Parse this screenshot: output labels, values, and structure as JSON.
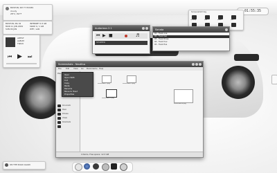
{
  "topbar": {
    "clock": "01:55:35"
  },
  "weather_panel": {
    "title": "BOSTON, SM 77 HOURS",
    "lines": [
      "cloudy",
      "28°C / 82°F",
      "humidity 40%"
    ]
  },
  "music_widget": {
    "title": "MUSIC",
    "lines": [
      "ARTIST",
      "ALBUM",
      "TRACK",
      "0:00"
    ]
  },
  "left_panel": {
    "lines": [
      "BOSTON, MA 02",
      "MON 11 JUN 2009",
      "SUN 09 JUN",
      "INTERNET 4.5 GB",
      "SWAP 0 / 1 GB",
      "WIFI / LAN"
    ]
  },
  "system_tray": {
    "title": "Screenshot tray",
    "labels": [
      "Desktop",
      "Mail",
      "Music",
      "Files",
      "Web",
      "Video",
      "Chat",
      "Trash"
    ]
  },
  "media_player": {
    "title": "Audacious 2.1",
    "status": "STOPPED"
  },
  "file_list": {
    "title": "Sonata",
    "rows": [
      "01 - Track one",
      "02 - Track two",
      "03 - Track three",
      "04 - Track four",
      "05 - Track five"
    ]
  },
  "file_manager": {
    "title": "Screenshots - Nautilus",
    "menu": [
      "File",
      "Edit",
      "View",
      "Go",
      "Bookmarks",
      "Help"
    ],
    "sidebar": [
      "Places",
      "Home",
      "Desktop",
      "File System",
      "Network",
      "Trash",
      "Documents",
      "Music",
      "Pictures",
      "Videos",
      "Downloads"
    ],
    "context_menu": [
      "Open",
      "Open With",
      "Cut",
      "Copy",
      "Paste",
      "Rename",
      "Move to Trash",
      "Properties"
    ],
    "files": [
      "Screenshot-1.png",
      "Screenshot-2.png",
      "Screenshot-3.png",
      "Screenshot-4.png"
    ],
    "status": "4 items, Free space: 12.3 GB"
  },
  "dock": {
    "items": [
      "home",
      "web",
      "mail",
      "music",
      "terminal",
      "settings"
    ]
  },
  "bottom_note": {
    "text": "ON THE ROAD AGAIN"
  }
}
